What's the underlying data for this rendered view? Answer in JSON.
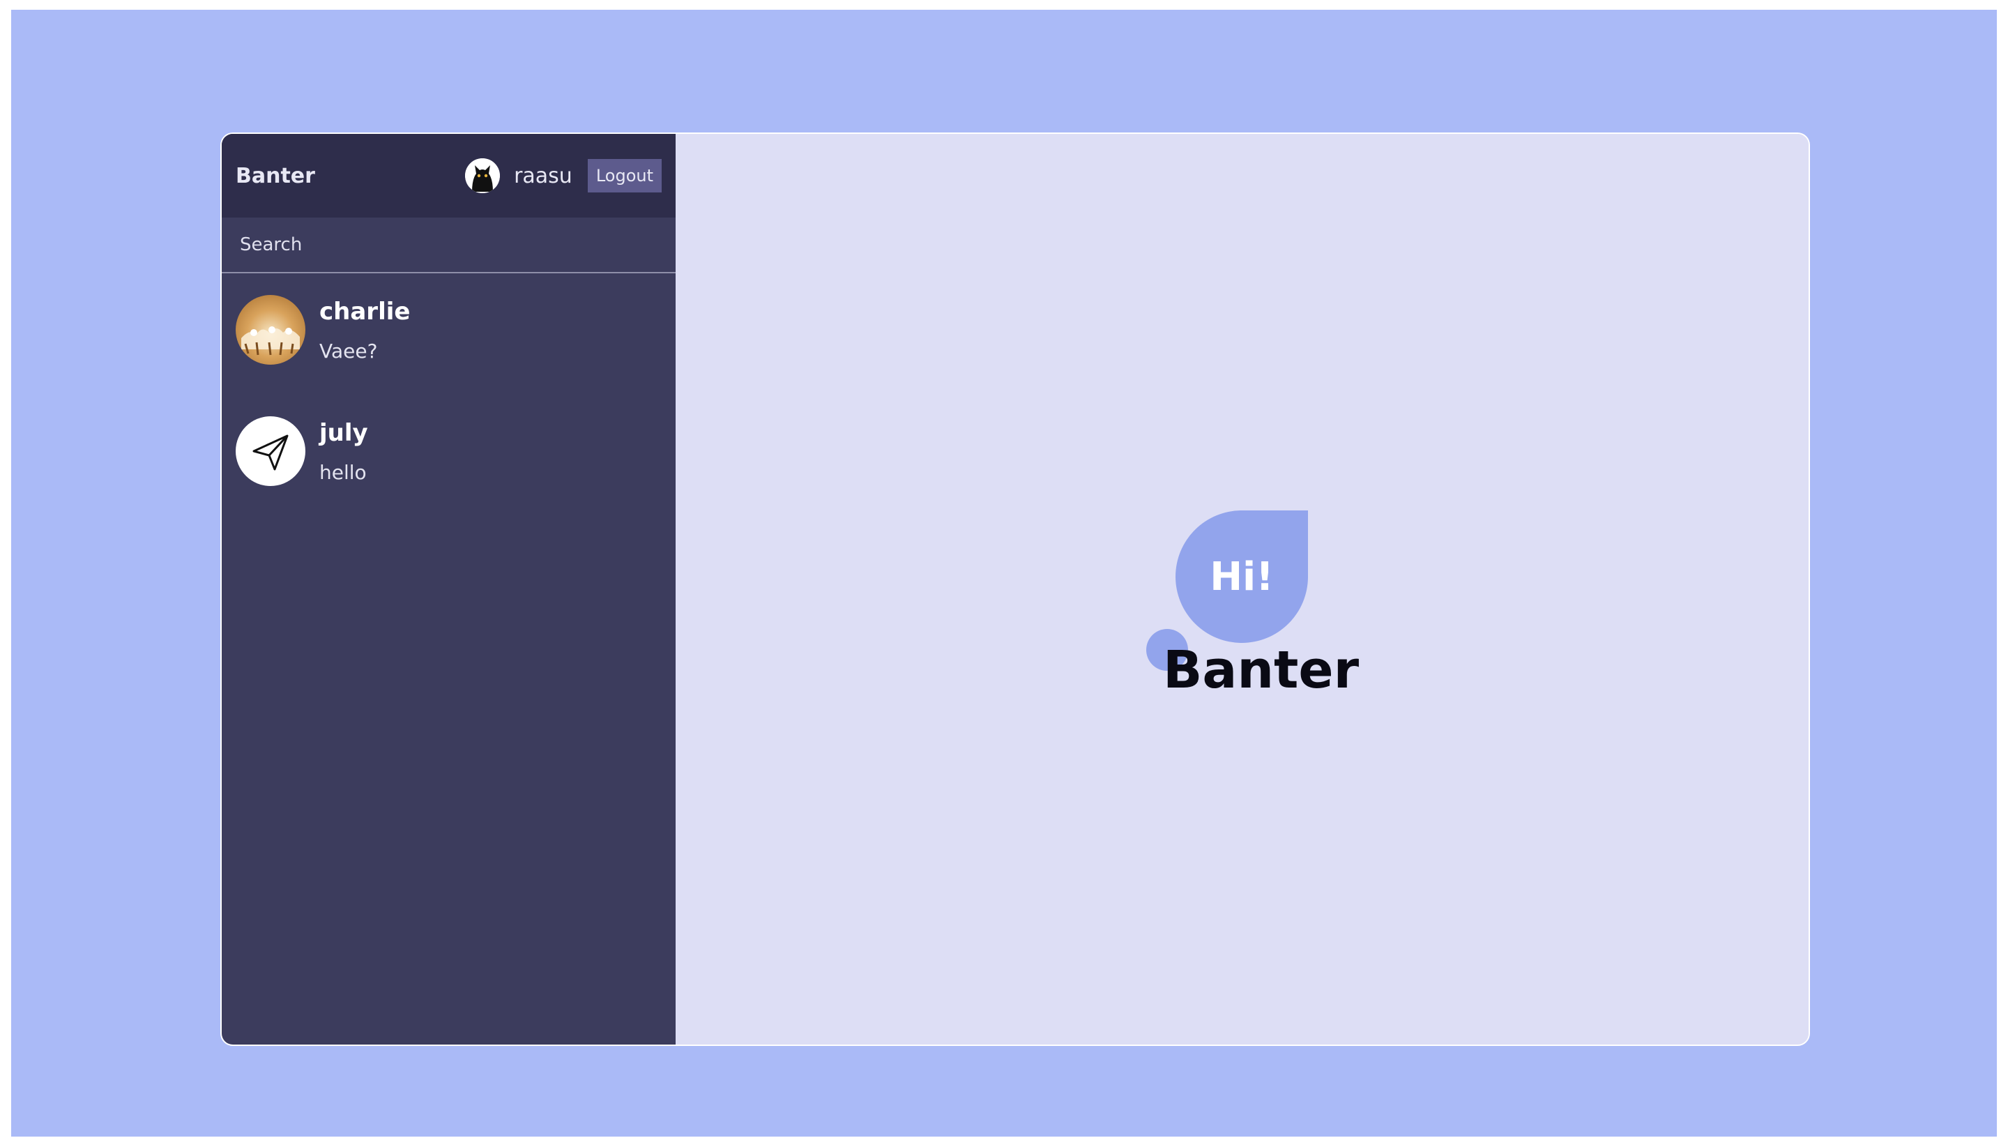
{
  "navbar": {
    "brand": "Banter",
    "user_name": "raasu",
    "logout_label": "Logout"
  },
  "search": {
    "placeholder": "Search"
  },
  "chats": [
    {
      "name": "charlie",
      "last_message": "Vaee?",
      "avatar": "horses-photo"
    },
    {
      "name": "july",
      "last_message": "hello",
      "avatar": "send-icon"
    }
  ],
  "welcome": {
    "bubble_text": "Hi!",
    "title": "Banter"
  },
  "colors": {
    "page_background": "#aabaf7",
    "sidebar": "#3c3c5d",
    "navbar": "#2e2d4b",
    "logout_button": "#5d5b8d",
    "main_background": "#dddef5",
    "accent": "#92a4ec"
  }
}
